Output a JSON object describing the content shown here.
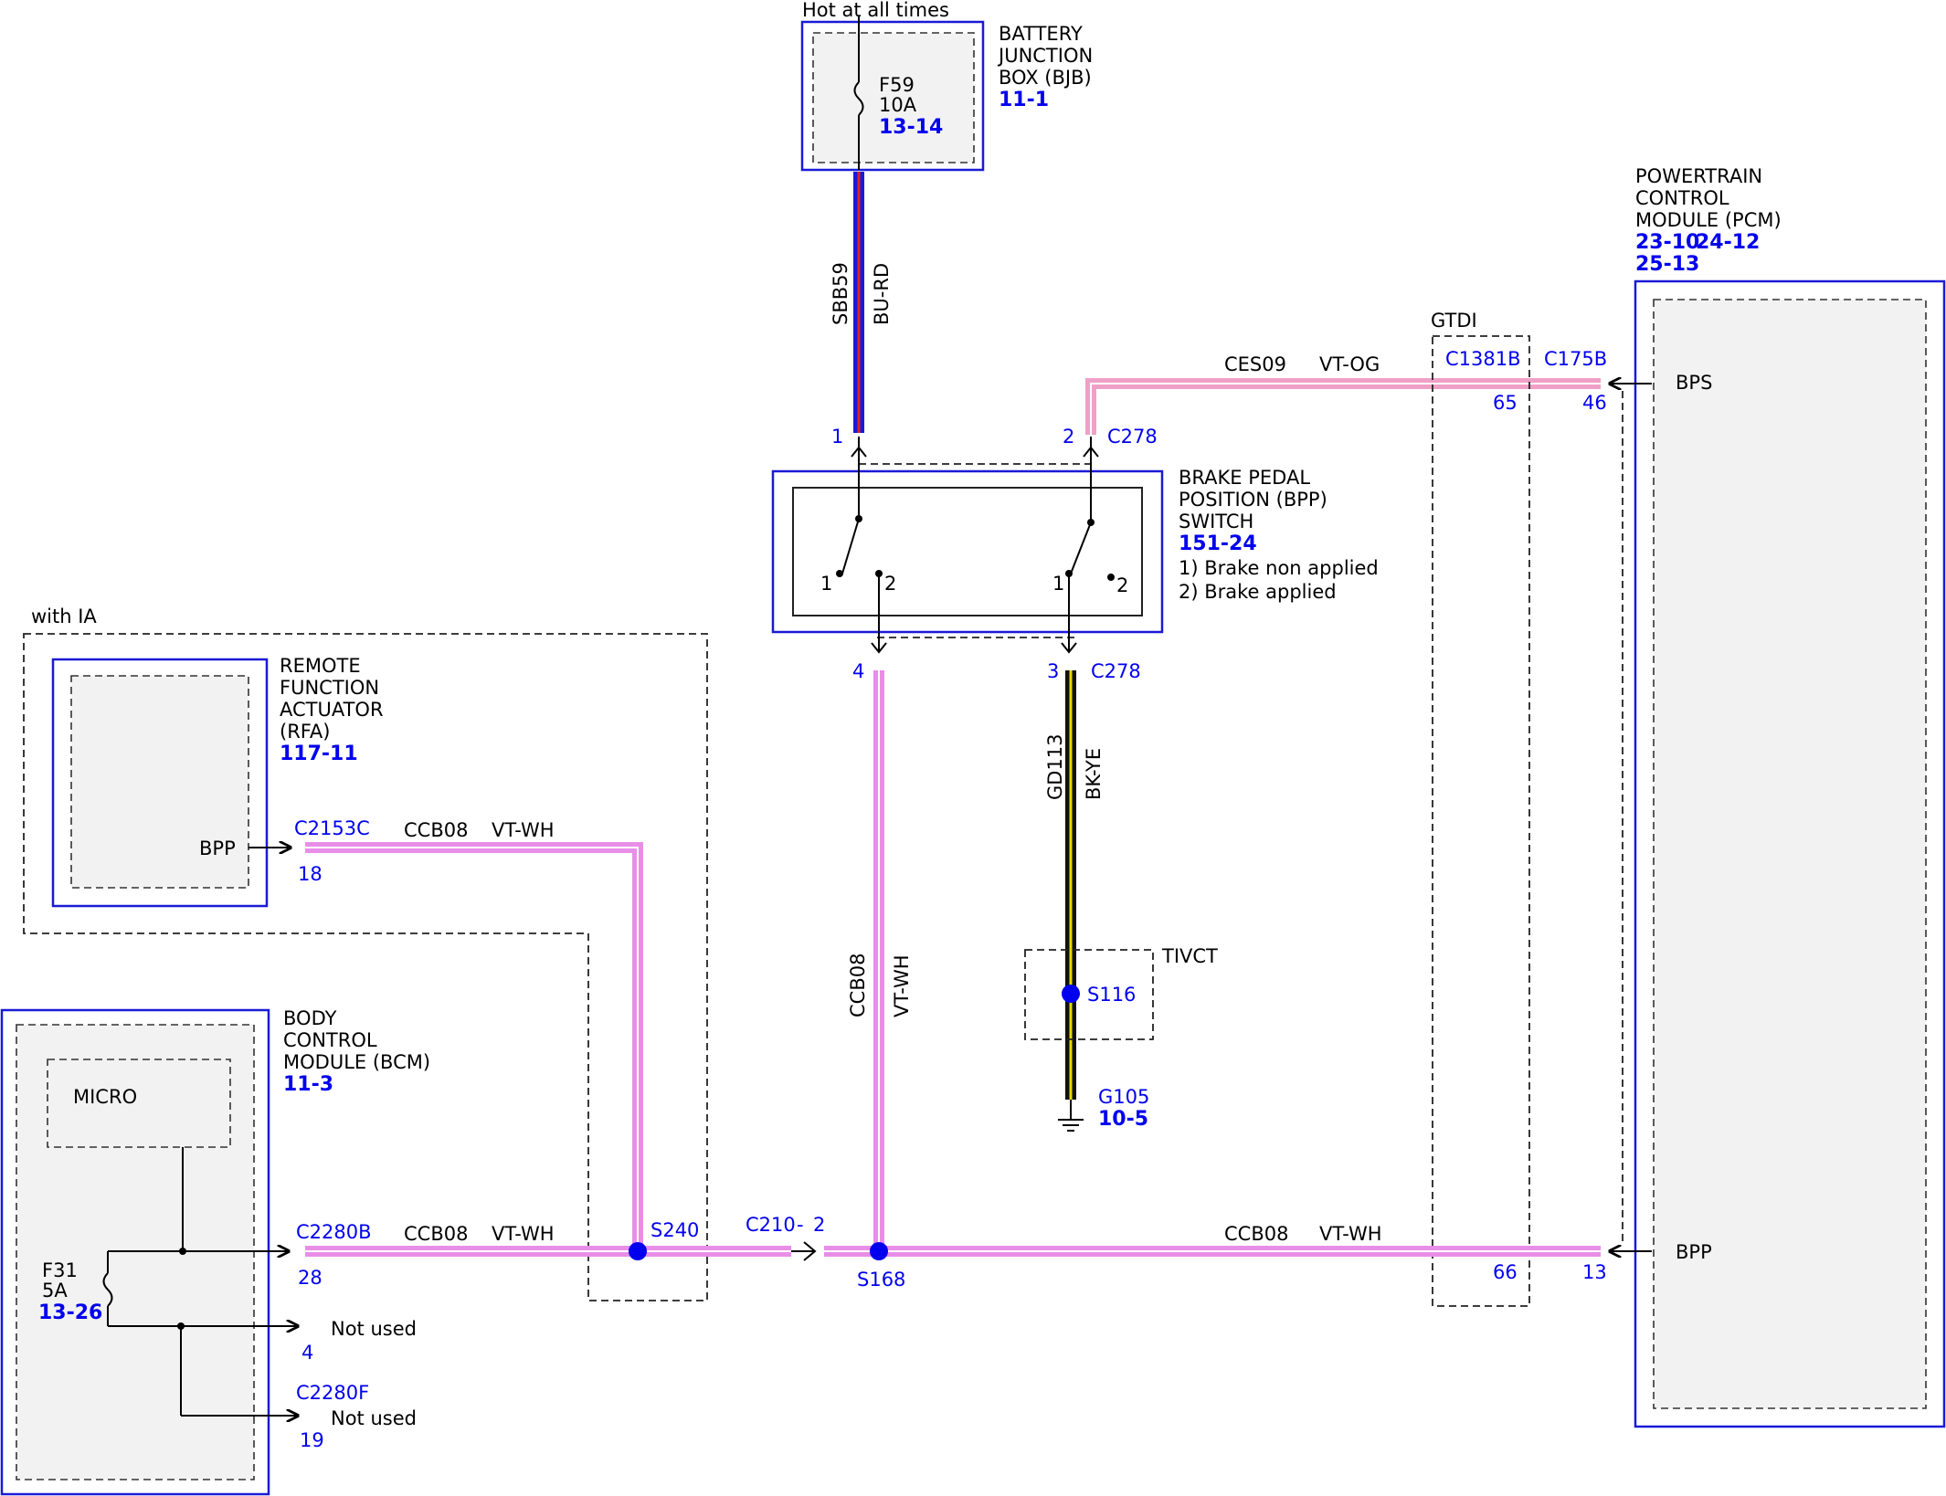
{
  "colors": {
    "module_border": "#1a1ad6",
    "connector_text": "#0000ee",
    "wire_vt_wh": "#e88ee8",
    "wire_vt_og": "#f0a0c8",
    "wire_bu_rd_blue": "#1a1ad6",
    "wire_bu_rd_red": "#e02020",
    "wire_bk_ye_black": "#111111",
    "wire_bk_ye_yellow": "#e8d800",
    "splice": "#0000ee"
  },
  "bjb": {
    "supply": "Hot at all times",
    "name": [
      "BATTERY",
      "JUNCTION",
      "BOX (BJB)"
    ],
    "ref": "11-1",
    "fuse": {
      "id": "F59",
      "rating": "10A",
      "ref": "13-14"
    }
  },
  "pcm": {
    "name": [
      "POWERTRAIN",
      "CONTROL",
      "MODULE (PCM)"
    ],
    "ref1": "23-10",
    "ref2": "24-12",
    "ref3": "25-13",
    "pin_bps": "BPS",
    "pin_bpp": "BPP"
  },
  "bpp_switch": {
    "name": [
      "BRAKE PEDAL",
      "POSITION (BPP)",
      "SWITCH"
    ],
    "ref": "151-24",
    "legend1": "1) Brake non applied",
    "legend2": "2) Brake applied",
    "contact_1": "1",
    "contact_2": "2",
    "connector_top": "C278",
    "connector_bottom": "C278",
    "pin_top_left": "1",
    "pin_top_right": "2",
    "pin_bottom_left": "4",
    "pin_bottom_right": "3"
  },
  "rfa": {
    "option": "with IA",
    "name": [
      "REMOTE",
      "FUNCTION",
      "ACTUATOR",
      "(RFA)"
    ],
    "ref": "117-11",
    "pin_name": "BPP",
    "connector": "C2153C",
    "pin": "18"
  },
  "bcm": {
    "name": [
      "BODY",
      "CONTROL",
      "MODULE (BCM)"
    ],
    "ref": "11-3",
    "micro": "MICRO",
    "fuse": {
      "id": "F31",
      "rating": "5A",
      "ref": "13-26"
    },
    "connector_b": "C2280B",
    "pin_28": "28",
    "pin_4": "4",
    "not_used_1": "Not used",
    "connector_f": "C2280F",
    "pin_19": "19",
    "not_used_2": "Not used"
  },
  "gtdi": {
    "label": "GTDI",
    "connector": "C1381B",
    "pin_top": "65",
    "pin_bottom": "66"
  },
  "pcm_connector": {
    "name": "C175B",
    "pin_bps": "46",
    "pin_bpp": "13"
  },
  "wires": {
    "sbb59_circuit": "SBB59",
    "sbb59_color": "BU-RD",
    "ces09_circuit": "CES09",
    "ces09_color": "VT-OG",
    "gd113_circuit": "GD113",
    "gd113_color": "BK-YE",
    "ccb08_circuit": "CCB08",
    "ccb08_color": "VT-WH"
  },
  "tivct": {
    "label": "TIVCT",
    "splice": "S116"
  },
  "ground": {
    "id": "G105",
    "ref": "10-5"
  },
  "splices": {
    "s240": "S240",
    "s168": "S168"
  },
  "c210": {
    "connector": "C210",
    "pin": "2",
    "separator": "-"
  }
}
